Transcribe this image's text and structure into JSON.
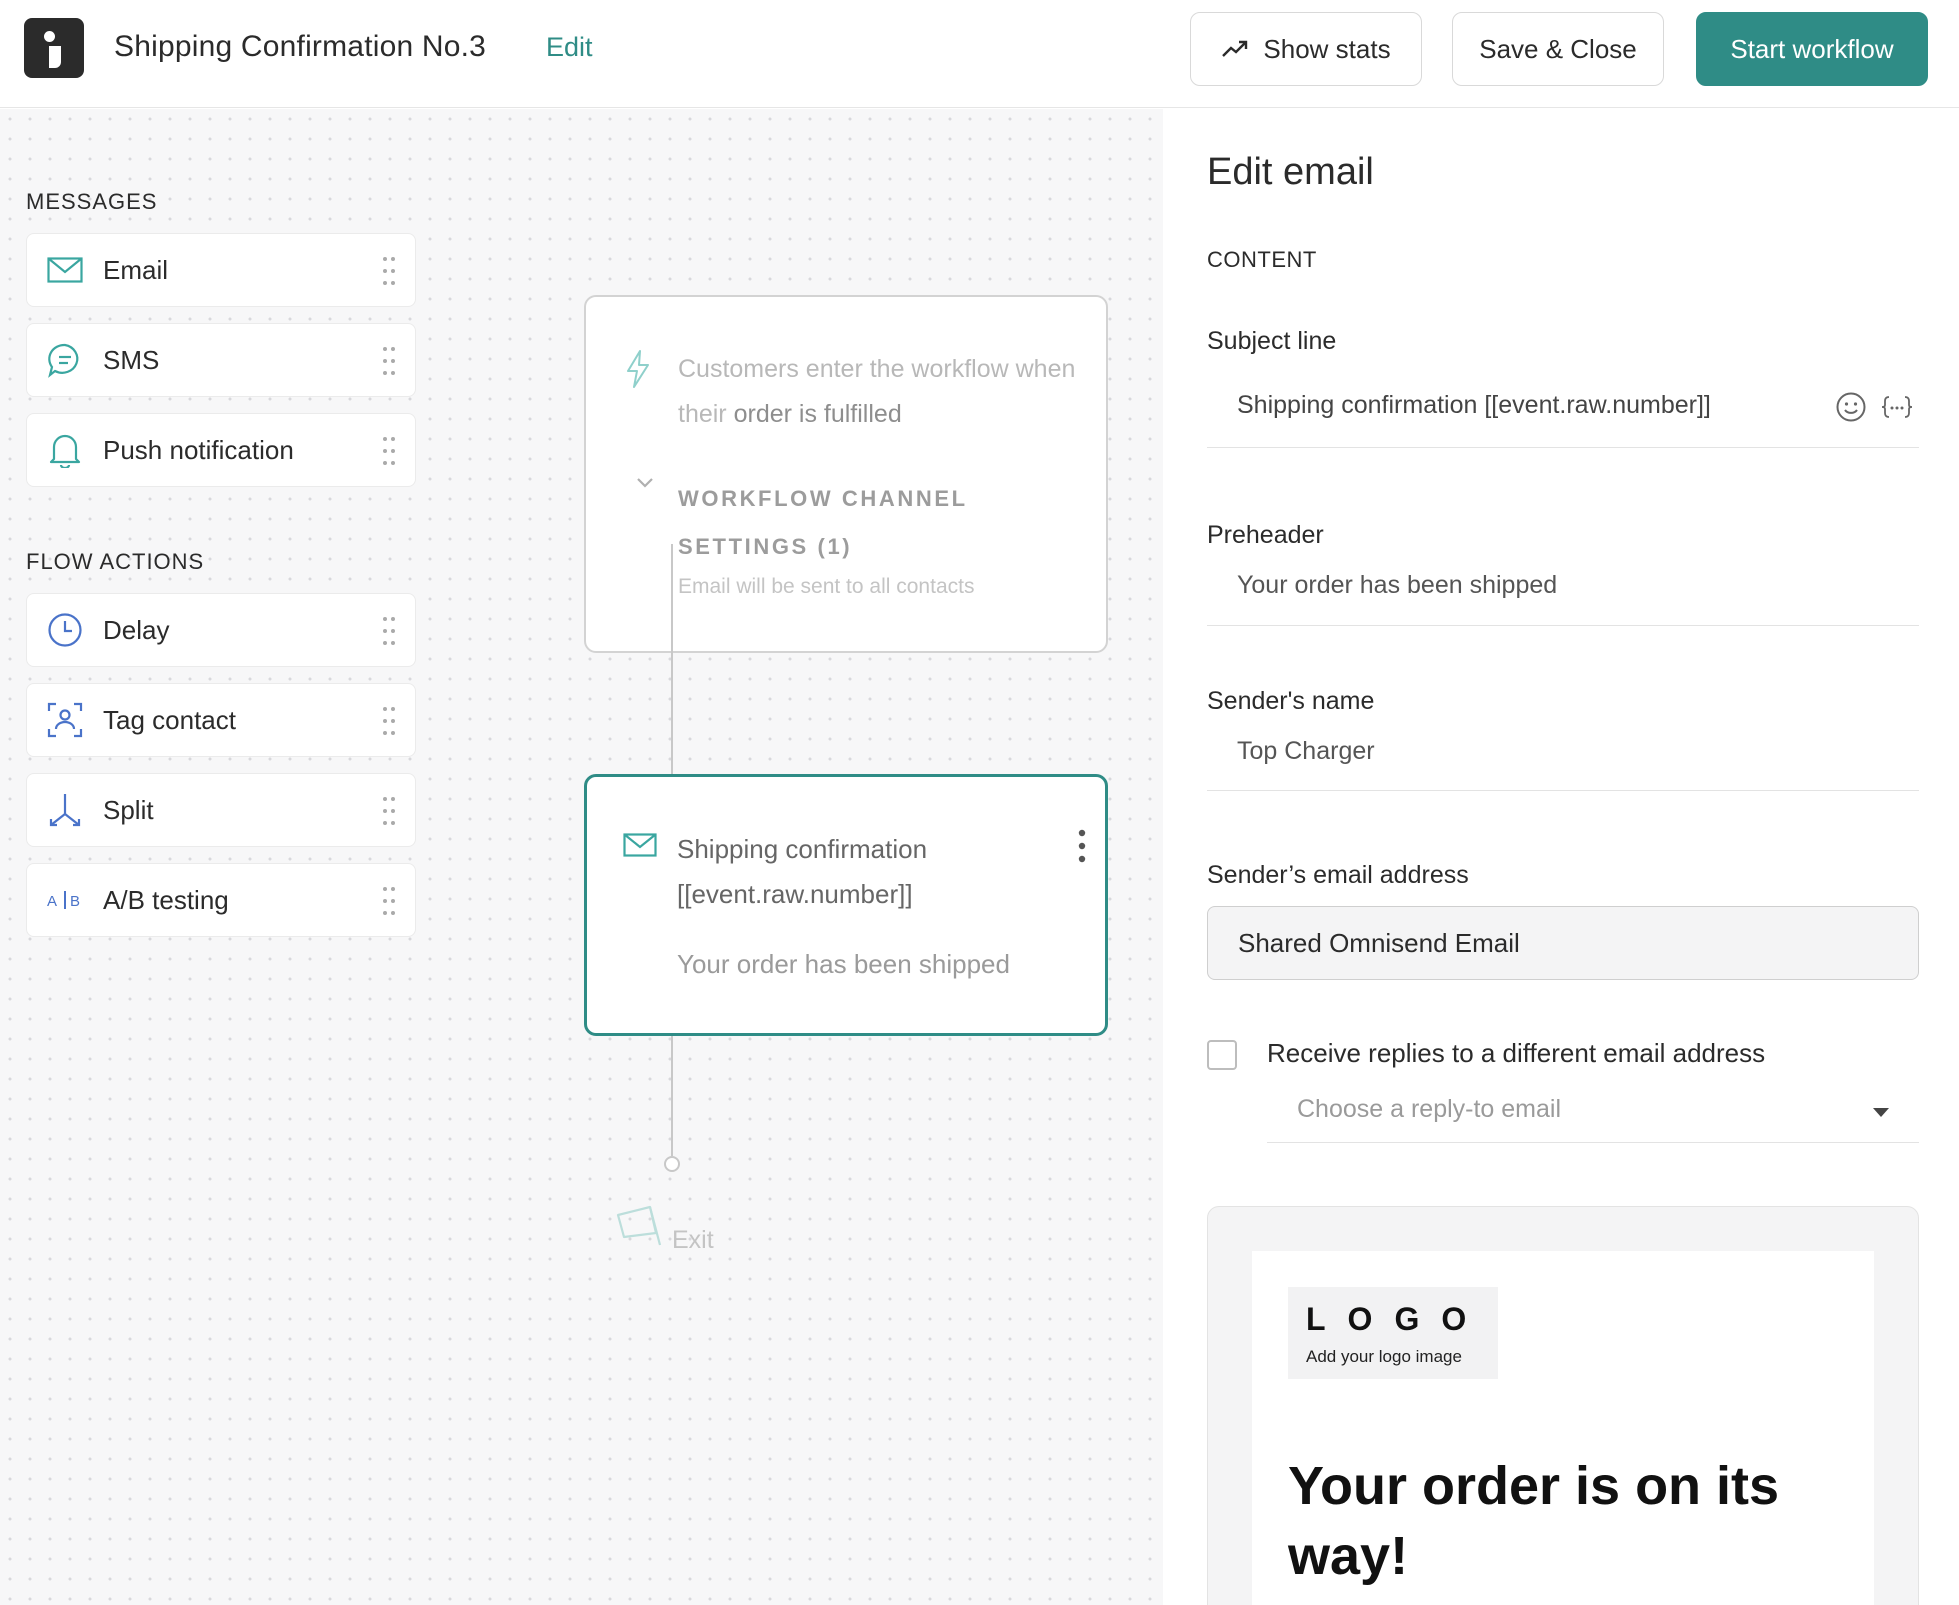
{
  "header": {
    "title": "Shipping Confirmation No.3",
    "edit_label": "Edit",
    "show_stats_label": "Show stats",
    "save_close_label": "Save & Close",
    "start_label": "Start workflow"
  },
  "library": {
    "messages_heading": "MESSAGES",
    "messages": [
      {
        "label": "Email",
        "icon": "envelope-icon"
      },
      {
        "label": "SMS",
        "icon": "chat-bubble-icon"
      },
      {
        "label": "Push notification",
        "icon": "bell-icon"
      }
    ],
    "actions_heading": "FLOW ACTIONS",
    "actions": [
      {
        "label": "Delay",
        "icon": "clock-icon"
      },
      {
        "label": "Tag contact",
        "icon": "tag-contact-icon"
      },
      {
        "label": "Split",
        "icon": "split-icon"
      },
      {
        "label": "A/B testing",
        "icon": "ab-testing-icon"
      }
    ]
  },
  "flow": {
    "trigger": {
      "text_prefix": "Customers enter the workflow when their ",
      "text_highlight": "order is fulfilled",
      "settings_label": "WORKFLOW CHANNEL SETTINGS (1)",
      "settings_note": "Email will be sent to all contacts"
    },
    "email_node": {
      "title": "Shipping confirmation [[event.raw.number]]",
      "preheader": "Your order has been shipped"
    },
    "exit_label": "Exit"
  },
  "panel": {
    "title": "Edit email",
    "content_heading": "CONTENT",
    "subject_label": "Subject line",
    "subject_value": "Shipping confirmation [[event.raw.number]]",
    "preheader_label": "Preheader",
    "preheader_value": "Your order has been shipped",
    "sender_name_label": "Sender's name",
    "sender_name_value": "Top Charger",
    "sender_email_label": "Sender’s email address",
    "sender_email_value": "Shared Omnisend Email",
    "reply_checkbox_label": "Receive replies to a different email address",
    "reply_placeholder": "Choose a reply-to email",
    "preview": {
      "logo_text": "LOGO",
      "logo_sub": "Add your logo image",
      "headline": "Your order is on its way!"
    }
  },
  "colors": {
    "accent": "#2f8c86",
    "icon_blue": "#4a73c9",
    "icon_teal": "#3aa6a0"
  }
}
